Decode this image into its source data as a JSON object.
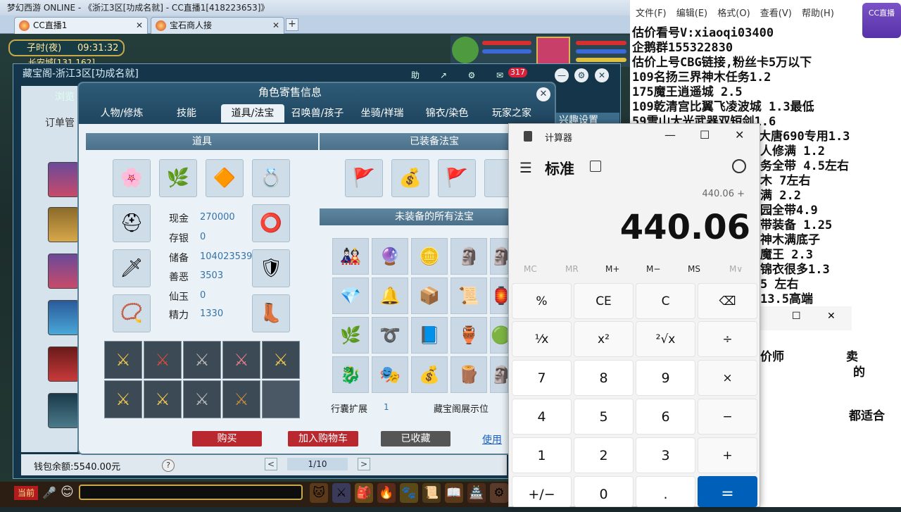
{
  "browser": {
    "title": "梦幻西游 ONLINE - 《浙江3区[功成名就] - CC直播1[418223653]》",
    "tabs": [
      {
        "label": "CC直播1"
      },
      {
        "label": "宝石商人接"
      }
    ],
    "new_tab": "+"
  },
  "game": {
    "clock_period": "子时(夜)",
    "clock_time": "09:31:32",
    "location": "长安城[131,162]",
    "cbg_window": {
      "title": "藏宝阁-浙江3区[功成名就]",
      "message_badge": "317",
      "left_tabs": [
        "浏览",
        "订单管"
      ],
      "right_link": "兴趣设置",
      "wallet_label": "钱包余额:",
      "wallet_value": "5540.00元",
      "help": "?",
      "pager": {
        "prev": "<",
        "page": "1/10",
        "next": ">"
      }
    },
    "dialog": {
      "title": "角色寄售信息",
      "tabs": [
        "人物/修炼",
        "技能",
        "道具/法宝",
        "召唤兽/孩子",
        "坐骑/祥瑞",
        "锦衣/染色",
        "玩家之家"
      ],
      "active_tab": "道具/法宝",
      "items_section": "道具",
      "equipped_section": "已装备法宝",
      "unequipped_section": "未装备的所有法宝",
      "stats": [
        {
          "label": "现金",
          "value": "270000"
        },
        {
          "label": "存银",
          "value": "0"
        },
        {
          "label": "储备",
          "value": "104023539"
        },
        {
          "label": "善恶",
          "value": "3503"
        },
        {
          "label": "仙玉",
          "value": "0"
        },
        {
          "label": "精力",
          "value": "1330"
        }
      ],
      "bag_expand_label": "行囊扩展",
      "bag_expand_value": "1",
      "showcase_label": "藏宝阁展示位",
      "buttons": {
        "buy": "购买",
        "add_cart": "加入购物车",
        "favorited": "已收藏",
        "use": "使用"
      }
    },
    "bottom": {
      "current_channel": "当前"
    }
  },
  "notepad": {
    "menu": [
      "文件(F)",
      "编辑(E)",
      "格式(O)",
      "查看(V)",
      "帮助(H)"
    ],
    "lines": [
      "估价看号V:xiaoqi03400",
      "企鹅群155322830",
      "估价上号CBG链接,粉丝卡5万以下",
      "109名扬三界神木任务1.2",
      "175魔王逍遥城 2.5",
      "109乾清宫比翼飞凌波城 1.3最低",
      "59雪山大光武器双短剑1.6"
    ],
    "right_fragments": [
      "大唐690专用1.3",
      "人修满 1.2",
      "务全带 4.5左右",
      "木 7左右",
      "满 2.2",
      "园全带4.9",
      "带装备 1.25",
      "神木满底子",
      "魔王 2.3",
      "锦衣很多1.3",
      "5 左右",
      "13.5高端"
    ],
    "window2_fragments": [
      "价师",
      "卖",
      "的",
      "都适合"
    ]
  },
  "stream_badge": "CC直播",
  "calculator": {
    "app_title": "计算器",
    "mode": "标准",
    "expression": "440.06 +",
    "display": "440.06",
    "memory": [
      "MC",
      "MR",
      "M+",
      "M−",
      "MS",
      "M∨"
    ],
    "keys": [
      [
        "%",
        "CE",
        "C",
        "⌫"
      ],
      [
        "¹⁄x",
        "x²",
        "²√x",
        "÷"
      ],
      [
        "7",
        "8",
        "9",
        "×"
      ],
      [
        "4",
        "5",
        "6",
        "−"
      ],
      [
        "1",
        "2",
        "3",
        "+"
      ],
      [
        "+/−",
        "0",
        ".",
        "="
      ]
    ]
  }
}
